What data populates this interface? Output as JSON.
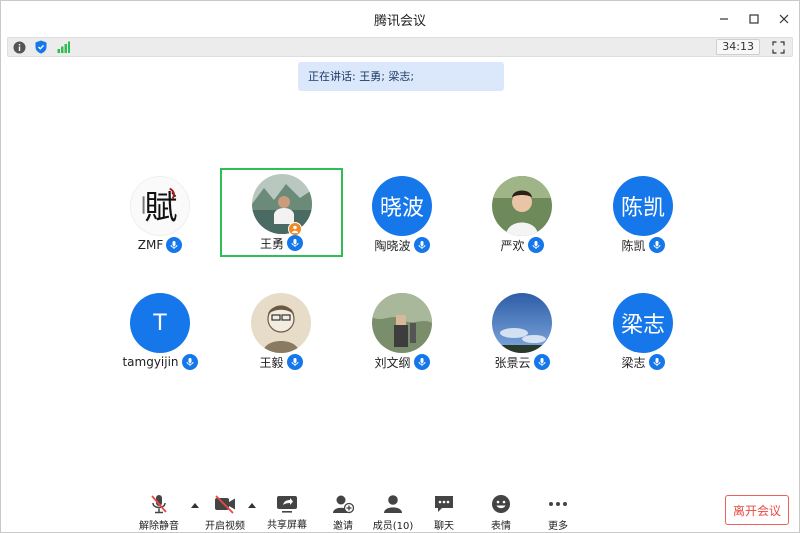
{
  "window": {
    "title": "腾讯会议"
  },
  "infobar": {
    "timer": "34:13"
  },
  "speaking_banner": "正在讲话: 王勇; 梁志;",
  "participants": [
    {
      "name": "ZMF",
      "avatar_type": "calligraphy",
      "avatar_glyph": "賦"
    },
    {
      "name": "王勇",
      "avatar_type": "photo",
      "active": true,
      "host": true
    },
    {
      "name": "陶晓波",
      "avatar_type": "text",
      "avatar_text": "晓波"
    },
    {
      "name": "严欢",
      "avatar_type": "photo"
    },
    {
      "name": "陈凯",
      "avatar_type": "text",
      "avatar_text": "陈凯"
    },
    {
      "name": "tamgyijin",
      "avatar_type": "text",
      "avatar_text": "T"
    },
    {
      "name": "王毅",
      "avatar_type": "photo"
    },
    {
      "name": "刘文纲",
      "avatar_type": "photo"
    },
    {
      "name": "张景云",
      "avatar_type": "photo"
    },
    {
      "name": "梁志",
      "avatar_type": "text",
      "avatar_text": "梁志"
    }
  ],
  "toolbar": {
    "unmute": "解除静音",
    "start_video": "开启视频",
    "share_screen": "共享屏幕",
    "invite": "邀请",
    "members": "成员(10)",
    "chat": "聊天",
    "reactions": "表情",
    "more": "更多",
    "leave": "离开会议"
  },
  "colors": {
    "accent_blue": "#1677ea",
    "active_green": "#2fbe56",
    "leave_red": "#e84a43",
    "banner_bg": "#dbe8fb",
    "host_orange": "#f08a24"
  },
  "icons": {
    "info": "info-icon",
    "security": "shield-icon",
    "signal": "signal-icon",
    "fullscreen": "fullscreen-icon",
    "minimize": "minimize-icon",
    "maximize": "maximize-icon",
    "close": "close-icon",
    "mic": "mic-icon",
    "mic_muted": "mic-muted-icon",
    "video_off": "video-off-icon",
    "share": "share-screen-icon",
    "invite": "invite-icon",
    "members": "members-icon",
    "chat": "chat-icon",
    "emoji": "emoji-icon",
    "more": "more-icon"
  }
}
